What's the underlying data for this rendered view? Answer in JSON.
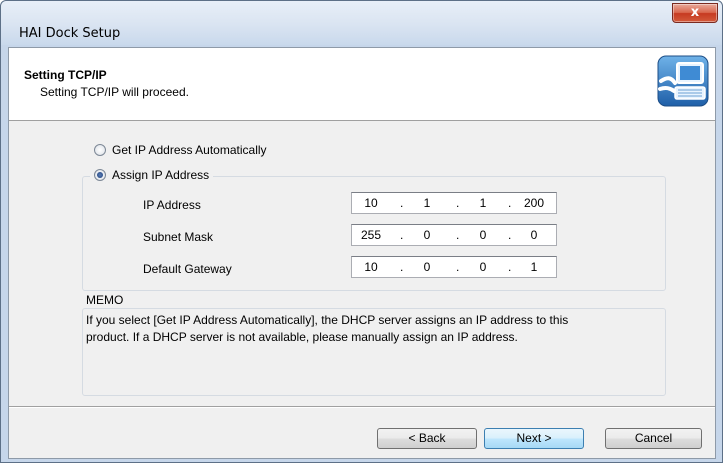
{
  "window": {
    "title": "HAI Dock Setup",
    "close_label": "x"
  },
  "header": {
    "title": "Setting TCP/IP",
    "subtitle": "Setting TCP/IP will proceed.",
    "icon": "computer-network-icon"
  },
  "options": {
    "auto": {
      "label": "Get IP Address Automatically",
      "checked": false
    },
    "assign": {
      "label": "Assign IP Address",
      "checked": true
    }
  },
  "fields": [
    {
      "label": "IP Address",
      "octets": [
        "10",
        "1",
        "1",
        "200"
      ]
    },
    {
      "label": "Subnet Mask",
      "octets": [
        "255",
        "0",
        "0",
        "0"
      ]
    },
    {
      "label": "Default Gateway",
      "octets": [
        "10",
        "0",
        "0",
        "1"
      ]
    }
  ],
  "memo": {
    "title": "MEMO",
    "line1": "If you select [Get IP Address Automatically], the DHCP server assigns an IP address to this",
    "line2": "product. If a DHCP server is not available, please manually assign an IP address."
  },
  "buttons": {
    "back": "< Back",
    "next": "Next >",
    "cancel": "Cancel"
  }
}
